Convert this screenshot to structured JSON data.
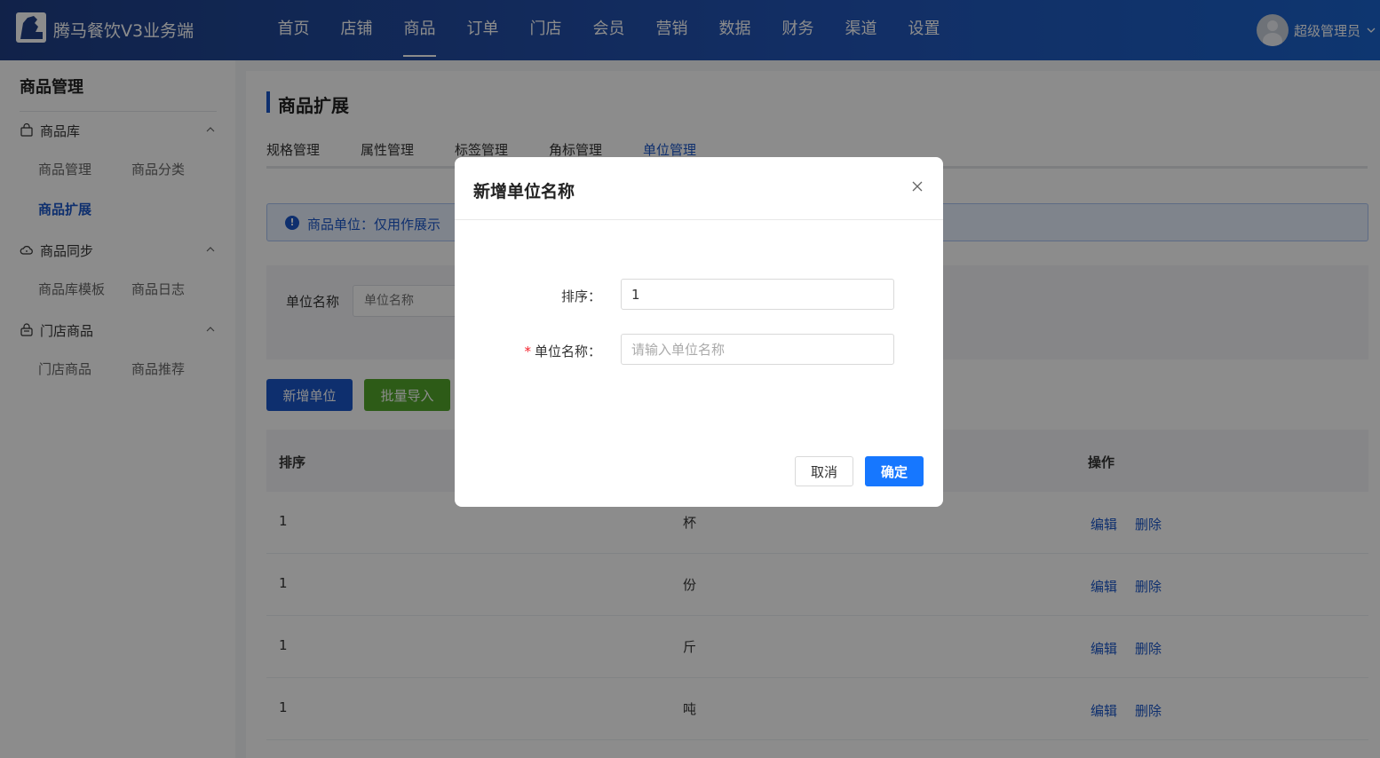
{
  "header": {
    "brand": "腾马餐饮V3业务端",
    "nav": [
      "首页",
      "店铺",
      "商品",
      "订单",
      "门店",
      "会员",
      "营销",
      "数据",
      "财务",
      "渠道",
      "设置"
    ],
    "active_nav": "商品",
    "user_name": "超级管理员"
  },
  "sidebar": {
    "title": "商品管理",
    "groups": [
      {
        "label": "商品库",
        "icon": "bag-icon",
        "items": [
          "商品管理",
          "商品分类",
          "商品扩展"
        ]
      },
      {
        "label": "商品同步",
        "icon": "cloud-sync-icon",
        "items": [
          "商品库模板",
          "商品日志"
        ]
      },
      {
        "label": "门店商品",
        "icon": "shopping-bag-icon",
        "items": [
          "门店商品",
          "商品推荐"
        ]
      }
    ],
    "active_item": "商品扩展"
  },
  "main": {
    "title": "商品扩展",
    "tabs": [
      "规格管理",
      "属性管理",
      "标签管理",
      "角标管理",
      "单位管理"
    ],
    "active_tab": "单位管理",
    "alert": "商品单位：仅用作展示",
    "filter": {
      "label": "单位名称",
      "placeholder": "单位名称"
    },
    "buttons": {
      "add": "新增单位",
      "import": "批量导入"
    },
    "table": {
      "columns": [
        "排序",
        "",
        "操作"
      ],
      "rows": [
        {
          "sort": "1",
          "name": "杯"
        },
        {
          "sort": "1",
          "name": "份"
        },
        {
          "sort": "1",
          "name": "斤"
        },
        {
          "sort": "1",
          "name": "吨"
        }
      ],
      "actions": {
        "edit": "编辑",
        "delete": "删除"
      }
    }
  },
  "modal": {
    "title": "新增单位名称",
    "fields": {
      "sort": {
        "label": "排序：",
        "value": "1"
      },
      "name": {
        "required_mark": "*",
        "label": "单位名称：",
        "placeholder": "请输入单位名称"
      }
    },
    "cancel": "取消",
    "confirm": "确定"
  },
  "colors": {
    "primary": "#1a56c9",
    "success": "#52a72a",
    "modal_primary": "#1677ff"
  }
}
